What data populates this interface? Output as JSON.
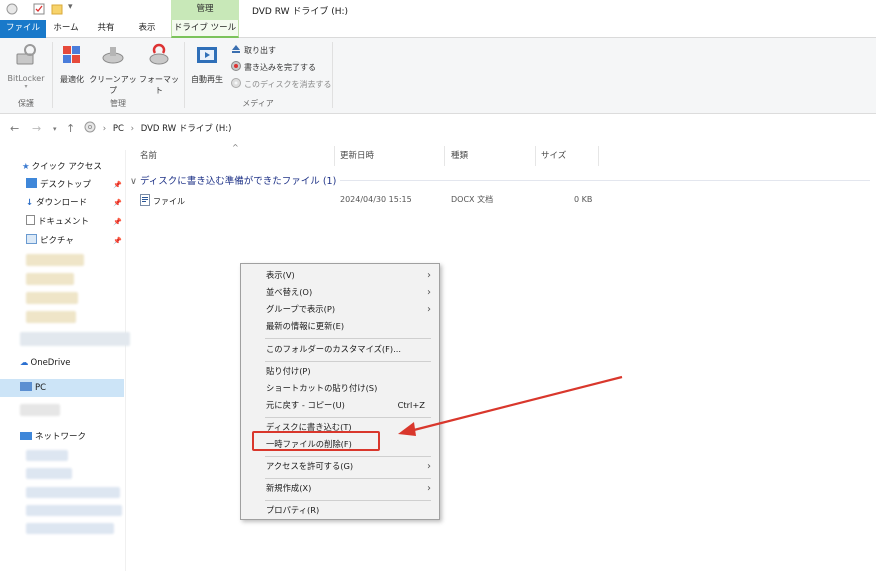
{
  "window": {
    "title": "DVD RW ドライブ (H:)"
  },
  "ribbon": {
    "context_header": "管理",
    "tabs": [
      "ファイル",
      "ホーム",
      "共有",
      "表示",
      "ドライブ ツール"
    ],
    "buttons": {
      "bitlocker": "BitLocker",
      "optimize": "最適化",
      "cleanup": "クリーンアップ",
      "format": "フォーマット",
      "autoplay": "自動再生",
      "eject": "取り出す",
      "finish_burning": "書き込みを完了する",
      "erase_disc": "このディスクを消去する"
    },
    "groups": {
      "protect": "保護",
      "manage": "管理",
      "media": "メディア"
    }
  },
  "address": {
    "segments": [
      "PC",
      "DVD RW ドライブ (H:)"
    ]
  },
  "sidebar": {
    "quick_access": "クイック アクセス",
    "items": [
      {
        "label": "デスクトップ",
        "pinned": true
      },
      {
        "label": "ダウンロード",
        "pinned": true
      },
      {
        "label": "ドキュメント",
        "pinned": true
      },
      {
        "label": "ピクチャ",
        "pinned": true
      }
    ],
    "onedrive": "OneDrive",
    "pc": "PC",
    "network": "ネットワーク"
  },
  "columns": {
    "name": "名前",
    "modified": "更新日時",
    "type": "種類",
    "size": "サイズ"
  },
  "group_header": "ディスクに書き込む準備ができたファイル (1)",
  "files": [
    {
      "name": "ファイル",
      "modified": "2024/04/30 15:15",
      "type": "DOCX 文档",
      "size": "0 KB"
    }
  ],
  "context_menu": {
    "view": "表示(V)",
    "sort": "並べ替え(O)",
    "group": "グループで表示(P)",
    "refresh": "最新の情報に更新(E)",
    "customize": "このフォルダーのカスタマイズ(F)...",
    "paste": "貼り付け(P)",
    "paste_shortcut": "ショートカットの貼り付け(S)",
    "undo": "元に戻す - コピー(U)",
    "undo_shortcut": "Ctrl+Z",
    "burn": "ディスクに書き込む(T)",
    "delete_temp": "一時ファイルの削除(F)",
    "give_access": "アクセスを許可する(G)",
    "new": "新規作成(X)",
    "properties": "プロパティ(R)"
  },
  "colors": {
    "accent": "#1979ca",
    "drive_tools": "#c8e8b8",
    "annotation": "#d9372c"
  },
  "icons": [
    "circle-icon",
    "checkbox-icon",
    "folder-icon",
    "pin-icon",
    "star-icon",
    "chevron-right-icon",
    "arrow-left-icon",
    "arrow-right-icon",
    "arrow-up-icon"
  ]
}
